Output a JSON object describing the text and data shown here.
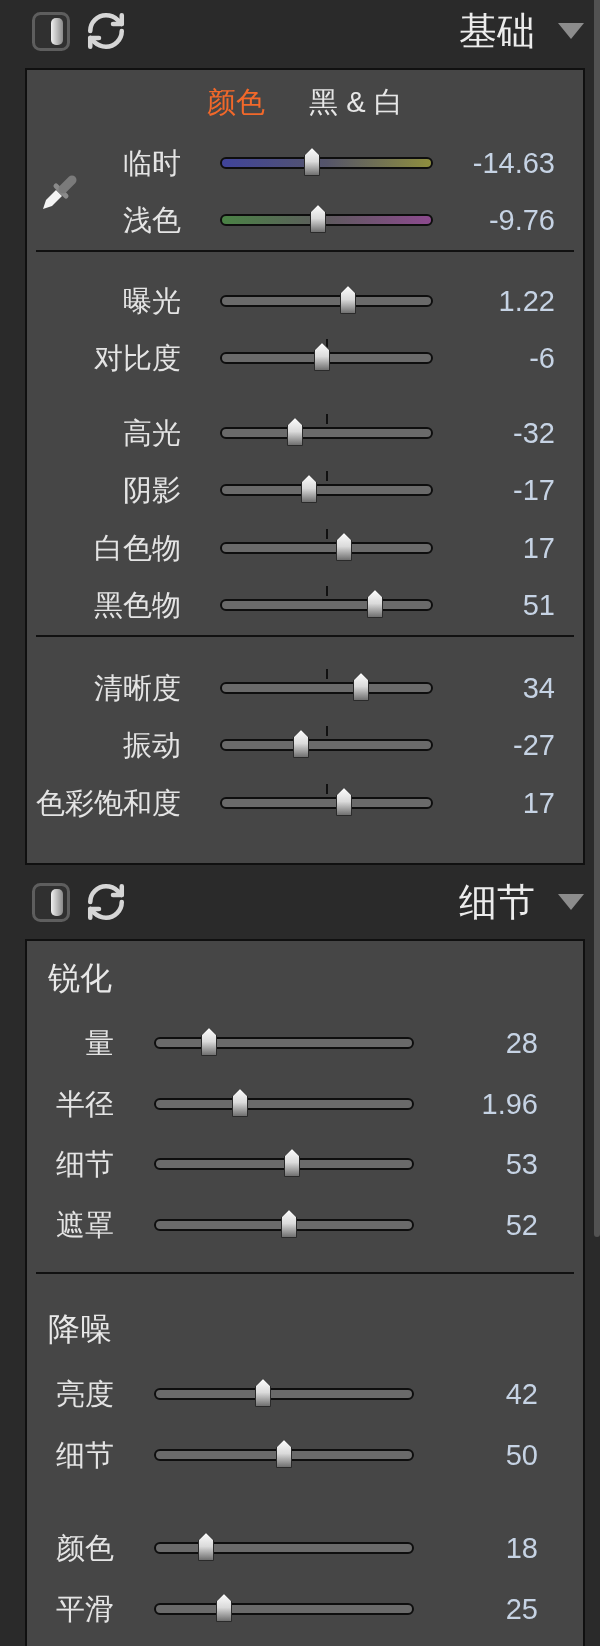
{
  "basic": {
    "title": "基础",
    "tabs": [
      {
        "label": "颜色",
        "selected": true
      },
      {
        "label": "黑 & 白",
        "selected": false
      }
    ],
    "sections": [
      {
        "kind": "picker",
        "groups": [
          {
            "sliders": [
              {
                "label": "临时",
                "kind": "temperature",
                "level": 0.43,
                "value": "-14.63"
              },
              {
                "label": "浅色",
                "kind": "tint",
                "level": 0.46,
                "value": "-9.76"
              }
            ]
          }
        ]
      },
      {
        "kind": "plain",
        "groups": [
          {
            "sliders": [
              {
                "label": "曝光",
                "kind": "plain",
                "level": 0.6,
                "value": "1.22"
              },
              {
                "label": "对比度",
                "kind": "centered",
                "level": 0.48,
                "value": "-6"
              }
            ]
          },
          {
            "sliders": [
              {
                "label": "高光",
                "kind": "centered",
                "level": 0.35,
                "value": "-32"
              },
              {
                "label": "阴影",
                "kind": "centered",
                "level": 0.42,
                "value": "-17"
              },
              {
                "label": "白色物",
                "kind": "centered",
                "level": 0.58,
                "value": "17"
              },
              {
                "label": "黑色物",
                "kind": "centered",
                "level": 0.73,
                "value": "51"
              }
            ]
          }
        ]
      },
      {
        "kind": "plain",
        "groups": [
          {
            "sliders": [
              {
                "label": "清晰度",
                "kind": "centered",
                "level": 0.66,
                "value": "34"
              },
              {
                "label": "振动",
                "kind": "centered",
                "level": 0.38,
                "value": "-27"
              },
              {
                "label": "色彩饱和度",
                "kind": "centered",
                "level": 0.58,
                "value": "17"
              }
            ]
          }
        ]
      }
    ]
  },
  "detail": {
    "title": "细节",
    "sections": [
      {
        "heading": "锐化",
        "groups": [
          {
            "sliders": [
              {
                "label": "量",
                "kind": "plain",
                "level": 0.21,
                "value": "28"
              },
              {
                "label": "半径",
                "kind": "plain",
                "level": 0.33,
                "value": "1.96"
              },
              {
                "label": "细节",
                "kind": "plain",
                "level": 0.53,
                "value": "53"
              },
              {
                "label": "遮罩",
                "kind": "plain",
                "level": 0.52,
                "value": "52"
              }
            ]
          }
        ]
      },
      {
        "heading": "降噪",
        "groups": [
          {
            "sliders": [
              {
                "label": "亮度",
                "kind": "plain",
                "level": 0.42,
                "value": "42"
              },
              {
                "label": "细节",
                "kind": "plain",
                "level": 0.5,
                "value": "50"
              }
            ]
          },
          {
            "sliders": [
              {
                "label": "颜色",
                "kind": "plain",
                "level": 0.2,
                "value": "18"
              },
              {
                "label": "平滑",
                "kind": "plain",
                "level": 0.27,
                "value": "25"
              }
            ]
          }
        ]
      }
    ]
  }
}
